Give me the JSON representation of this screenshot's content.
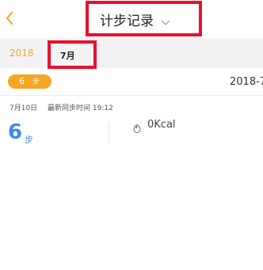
{
  "header": {
    "back_icon": "chevron-left-icon",
    "title": "计步记录",
    "title_icon": "chevron-down-icon"
  },
  "date_nav": {
    "year": "2018",
    "month": "7月"
  },
  "summary": {
    "steps": "6",
    "unit": "步",
    "date": "2018-7"
  },
  "record": {
    "date": "7月10日",
    "sync": "最新同步时间 19:12",
    "steps": "6",
    "unit": "步",
    "calories": "0Kcal",
    "calorie_icon": "flame-icon"
  },
  "colors": {
    "accent": "#f5a623",
    "steps_blue": "#3a8ee6",
    "highlight_red": "#e8112d"
  }
}
